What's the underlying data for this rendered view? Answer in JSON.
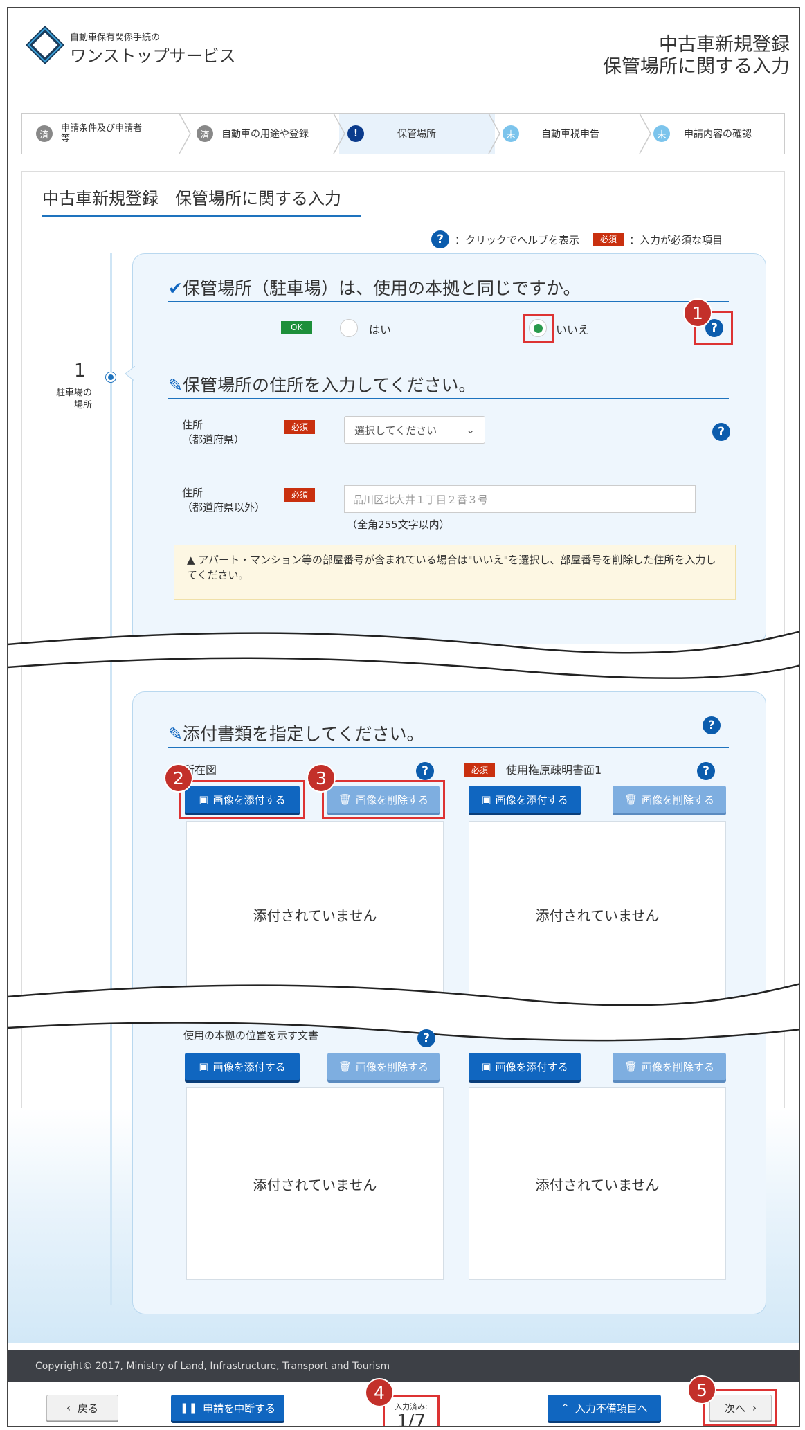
{
  "header": {
    "logo_sub": "自動車保有関係手続の",
    "logo_main": "ワンストップサービス",
    "title_line1": "中古車新規登録",
    "title_line2": "保管場所に関する入力"
  },
  "stepper": [
    {
      "badge": "済",
      "label": "申請条件及び申請者等",
      "state": "done"
    },
    {
      "badge": "済",
      "label": "自動車の用途や登録",
      "state": "done"
    },
    {
      "badge": "!",
      "label": "保管場所",
      "state": "current"
    },
    {
      "badge": "未",
      "label": "自動車税申告",
      "state": "todo"
    },
    {
      "badge": "未",
      "label": "申請内容の確認",
      "state": "todo"
    }
  ],
  "page_title": "中古車新規登録　保管場所に関する入力",
  "legend": {
    "help_text": "：クリックでヘルプを表示",
    "required_badge": "必須",
    "required_text": "：入力が必須な項目"
  },
  "timeline": {
    "number": "1",
    "label": "駐車場の場所"
  },
  "q1": {
    "title": "保管場所（駐車場）は、使用の本拠と同じですか。",
    "ok_badge": "OK",
    "options": [
      "はい",
      "いいえ"
    ],
    "selected": "いいえ"
  },
  "q2": {
    "title": "保管場所の住所を入力してください。",
    "pref_label_1": "住所",
    "pref_label_2": "（都道府県）",
    "pref_placeholder": "選択してください",
    "addr_label_1": "住所",
    "addr_label_2": "（都道府県以外）",
    "addr_placeholder": "品川区北大井１丁目２番３号",
    "addr_note": "（全角255文字以内）",
    "warning": "アパート・マンション等の部屋番号が含まれている場合は\"いいえ\"を選択し、部屋番号を削除した住所を入力してください。",
    "required_badge": "必須"
  },
  "attach": {
    "title": "添付書類を指定してください。",
    "attach_label": "画像を添付する",
    "delete_label": "画像を削除する",
    "empty_text": "添付されていません",
    "required_badge": "必須",
    "doc1": "所在図",
    "doc2": "使用権原疎明書面1",
    "doc3": "使用の本拠の位置を示す文書"
  },
  "callouts": [
    "1",
    "2",
    "3",
    "4",
    "5"
  ],
  "footer": {
    "copyright": "Copyright© 2017, Ministry of Land, Infrastructure, Transport and Tourism"
  },
  "bottom_bar": {
    "back": "戻る",
    "suspend": "申請を中断する",
    "progress_label": "入力済み:",
    "progress_value": "1/7",
    "incomplete": "入力不備項目へ",
    "next": "次へ"
  },
  "colors": {
    "accent": "#1066c0",
    "required": "#c9300f",
    "ok": "#1d8f3a",
    "callout": "#c3302a"
  }
}
